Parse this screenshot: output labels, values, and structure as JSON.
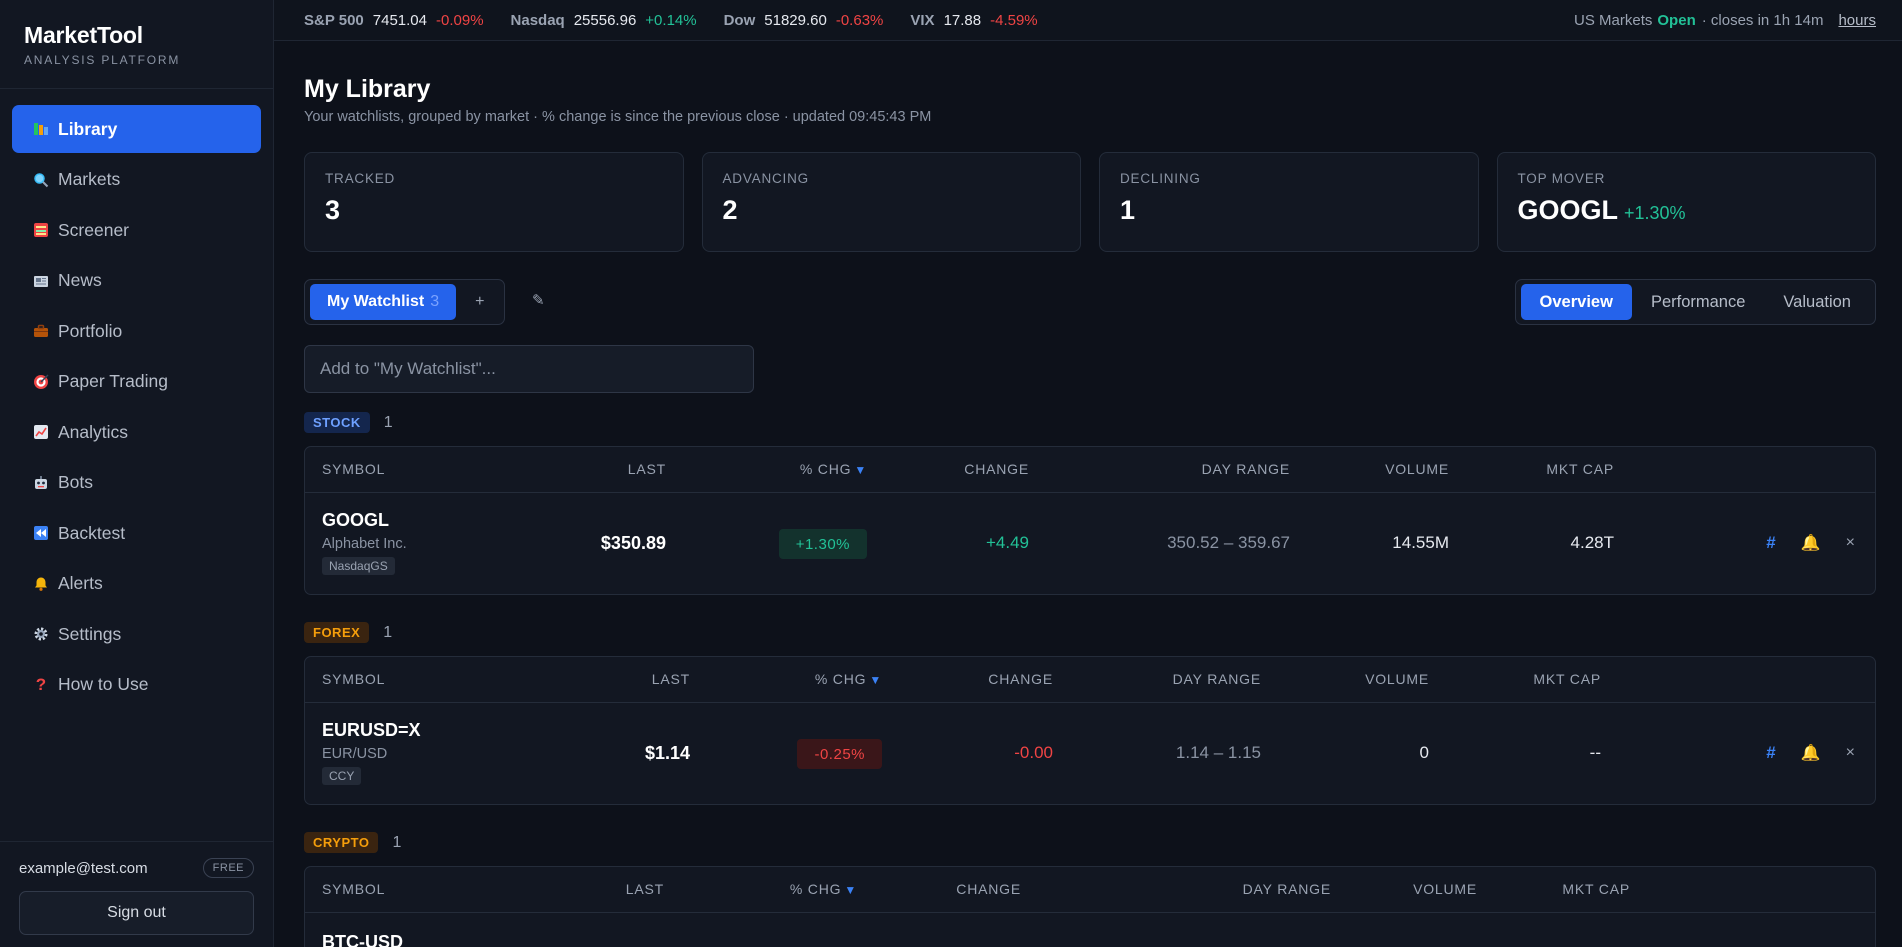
{
  "brand": {
    "title": "MarketTool",
    "subtitle": "ANALYSIS PLATFORM"
  },
  "nav": [
    {
      "label": "Library",
      "icon": "library-icon",
      "active": true
    },
    {
      "label": "Markets",
      "icon": "search-icon"
    },
    {
      "label": "Screener",
      "icon": "screener-icon"
    },
    {
      "label": "News",
      "icon": "newspaper-icon"
    },
    {
      "label": "Portfolio",
      "icon": "briefcase-icon"
    },
    {
      "label": "Paper Trading",
      "icon": "target-icon"
    },
    {
      "label": "Analytics",
      "icon": "chart-icon"
    },
    {
      "label": "Bots",
      "icon": "robot-icon"
    },
    {
      "label": "Backtest",
      "icon": "rewind-icon"
    },
    {
      "label": "Alerts",
      "icon": "bell-icon"
    },
    {
      "label": "Settings",
      "icon": "gear-icon"
    },
    {
      "label": "How to Use",
      "icon": "question-icon"
    }
  ],
  "user": {
    "email": "example@test.com",
    "plan": "FREE",
    "signout": "Sign out"
  },
  "ticker": [
    {
      "name": "S&P 500",
      "value": "7451.04",
      "change": "-0.09%",
      "dir": "neg"
    },
    {
      "name": "Nasdaq",
      "value": "25556.96",
      "change": "+0.14%",
      "dir": "pos"
    },
    {
      "name": "Dow",
      "value": "51829.60",
      "change": "-0.63%",
      "dir": "neg"
    },
    {
      "name": "VIX",
      "value": "17.88",
      "change": "-4.59%",
      "dir": "neg"
    }
  ],
  "market_status": {
    "prefix": "US Markets",
    "state": "Open",
    "closes": "· closes in 1h 14m",
    "hours_link": "hours"
  },
  "page": {
    "title": "My Library",
    "subtitle": "Your watchlists, grouped by market · % change is since the previous close · updated 09:45:43 PM"
  },
  "stats": {
    "tracked": {
      "label": "TRACKED",
      "value": "3"
    },
    "advancing": {
      "label": "ADVANCING",
      "value": "2"
    },
    "declining": {
      "label": "DECLINING",
      "value": "1"
    },
    "top_mover": {
      "label": "TOP MOVER",
      "symbol": "GOOGL",
      "change": "+1.30%"
    }
  },
  "watchlist": {
    "name": "My Watchlist",
    "count": "3",
    "add": "+",
    "edit": "✎"
  },
  "view_tabs": [
    "Overview",
    "Performance",
    "Valuation"
  ],
  "add_input": {
    "placeholder": "Add to \"My Watchlist\"..."
  },
  "columns": {
    "symbol": "SYMBOL",
    "last": "LAST",
    "pct": "% CHG",
    "change": "CHANGE",
    "range": "DAY RANGE",
    "volume": "VOLUME",
    "mktcap": "MKT CAP"
  },
  "sections": {
    "stock": {
      "badge": "STOCK",
      "count": "1",
      "rows": [
        {
          "symbol": "GOOGL",
          "name": "Alphabet Inc.",
          "exchange": "NasdaqGS",
          "last": "$350.89",
          "pct": "+1.30%",
          "change": "+4.49",
          "range": "350.52 – 359.67",
          "volume": "14.55M",
          "mktcap": "4.28T",
          "dir": "pos"
        }
      ]
    },
    "forex": {
      "badge": "FOREX",
      "count": "1",
      "rows": [
        {
          "symbol": "EURUSD=X",
          "name": "EUR/USD",
          "exchange": "CCY",
          "last": "$1.14",
          "pct": "-0.25%",
          "change": "-0.00",
          "range": "1.14 – 1.15",
          "volume": "0",
          "mktcap": "--",
          "dir": "neg"
        }
      ]
    },
    "crypto": {
      "badge": "CRYPTO",
      "count": "1",
      "rows": [
        {
          "symbol": "BTC-USD"
        }
      ]
    }
  },
  "row_actions": {
    "hash": "#",
    "bell": "🔔",
    "remove": "×"
  },
  "colors": {
    "accent": "#2563eb",
    "positive": "#22c197",
    "negative": "#ef4444",
    "background": "#0d111a"
  }
}
